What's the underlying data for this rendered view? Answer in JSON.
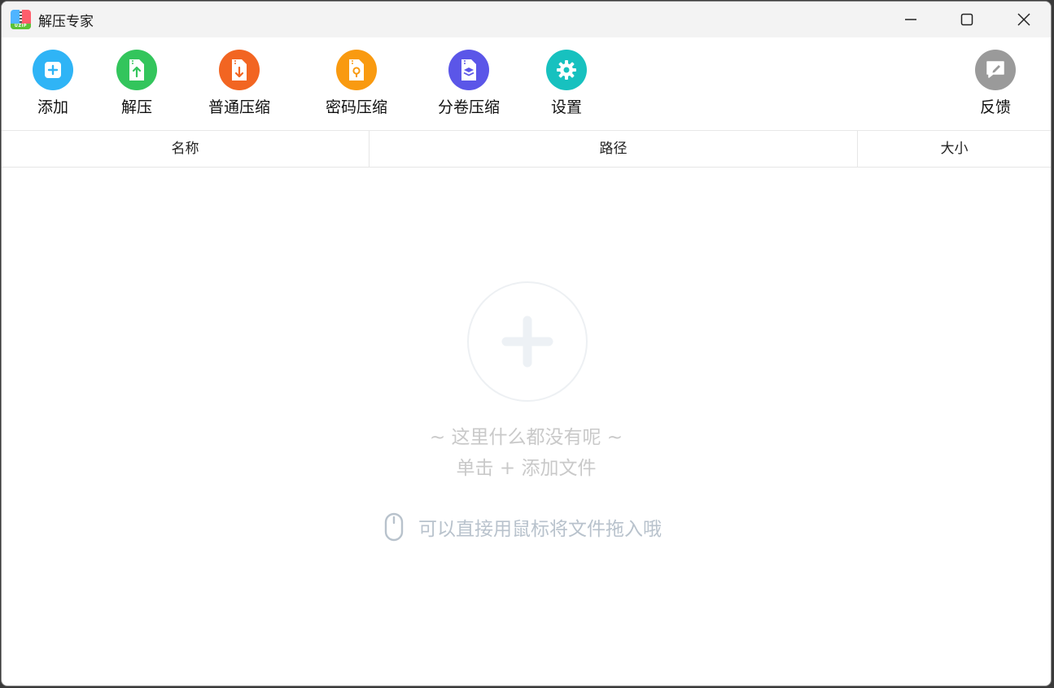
{
  "window": {
    "title": "解压专家",
    "app_icon": "uzip-app-icon",
    "app_icon_text": "UZIP"
  },
  "toolbar": {
    "items": [
      {
        "label": "添加",
        "icon": "plus-icon",
        "color": "#2fb4f6"
      },
      {
        "label": "解压",
        "icon": "extract-file-icon",
        "color": "#33c55c"
      },
      {
        "label": "普通压缩",
        "icon": "compress-file-icon",
        "color": "#f26522"
      },
      {
        "label": "密码压缩",
        "icon": "lock-file-icon",
        "color": "#f99a10"
      },
      {
        "label": "分卷压缩",
        "icon": "layers-file-icon",
        "color": "#5b56e8"
      },
      {
        "label": "设置",
        "icon": "gear-icon",
        "color": "#17c1bf"
      }
    ],
    "feedback": {
      "label": "反馈",
      "icon": "feedback-edit-icon",
      "color": "#9a9a9a"
    }
  },
  "table": {
    "columns": [
      "名称",
      "路径",
      "大小"
    ]
  },
  "empty_state": {
    "line1": "~ 这里什么都没有呢 ~",
    "line2": "单击 + 添加文件",
    "hint": "可以直接用鼠标将文件拖入哦"
  }
}
